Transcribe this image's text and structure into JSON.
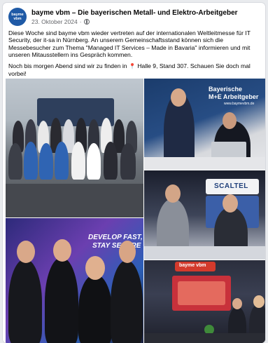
{
  "post": {
    "avatar_text_line1": "bayme",
    "avatar_text_line2": "vbm",
    "page_name": "bayme vbm – Die bayerischen Metall- und Elektro-Arbeitgeber",
    "date": "23. Oktober 2024",
    "separator": "·",
    "paragraph_1": "Diese Woche sind bayme vbm wieder vertreten auf der internationalen Weltleitmesse für IT Security, der it-sa in Nürnberg. An unserem Gemeinschaftsstand können sich die Messebesucher zum Thema \"Managed IT Services – Made in Bavaria\" informieren und mit unseren Mitausstellern ins Gespräch kommen.",
    "paragraph_2_before": "Noch bis morgen Abend sind wir zu finden in ",
    "paragraph_2_after": " Halle 9, Stand 307. Schauen Sie doch mal vorbei!"
  },
  "photos": {
    "photo_2_sign_line1": "Bayerische",
    "photo_2_sign_line2": "M+E Arbeitgeber",
    "photo_2_sign_url": "www.baymevbm.de",
    "photo_3_sign": "SCALTEL",
    "photo_4_screen_line1": "DEVELOP FAST,",
    "photo_4_screen_line2": "STAY SECURE",
    "photo_5_sign": "bayme vbm"
  },
  "colors": {
    "brand_blue": "#1f5aa6",
    "pin_red": "#e0302a",
    "text": "#050505",
    "meta": "#65676b"
  },
  "icons": {
    "globe": "globe-icon",
    "pin": "location-pin-icon"
  }
}
